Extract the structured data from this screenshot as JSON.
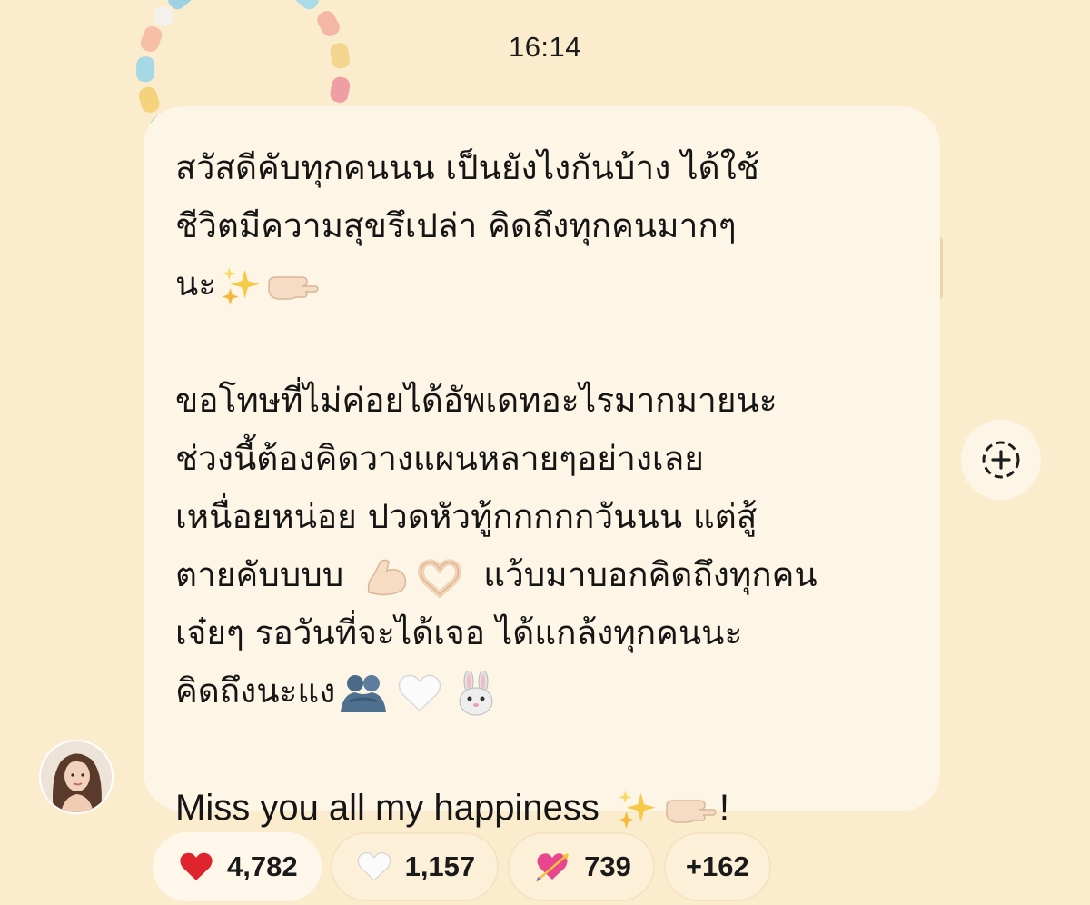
{
  "timestamp": "16:14",
  "message": {
    "lines": [
      "สวัสดีคับทุกคนนน เป็นยังไงกันบ้าง ได้ใช้",
      "ชีวิตมีความสุขรึเปล่า คิดถึงทุกคนมากๆ",
      "นะ",
      "",
      "ขอโทษที่ไม่ค่อยได้อัพเดทอะไรมากมายนะ",
      "ช่วงนี้ต้องคิดวางแผนหลายๆอย่างเลย",
      "เหนื่อยหน่อย ปวดหัวทู้กกกกกวันนน แต่สู้",
      "ตายคับบบบ",
      "แว้บมาบอกคิดถึงทุกคน",
      "เจ๋ยๆ รอวันที่จะได้เจอ ได้แกล้งทุกคนนะ",
      "คิดถึงนะแง",
      "",
      "Miss you all my happiness",
      "!"
    ],
    "emojis": [
      "sparkles",
      "pointing-hand",
      "flexed-biceps",
      "heart-hands",
      "people-hugging",
      "white-heart",
      "rabbit-face"
    ]
  },
  "reactions": [
    {
      "icon": "red-heart-icon",
      "count": "4,782"
    },
    {
      "icon": "white-heart-icon",
      "count": "1,157"
    },
    {
      "icon": "heart-arrow-icon",
      "count": "739"
    }
  ],
  "more_reactions": "+162",
  "colors": {
    "background": "#fbeccd",
    "bubble": "#fdf6e6",
    "pill": "#fcf0d8",
    "red_heart": "#e0242e"
  }
}
